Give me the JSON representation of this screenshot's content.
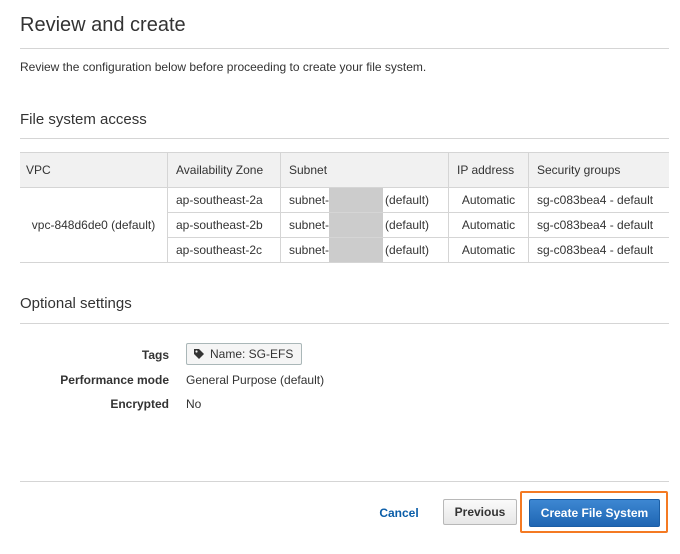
{
  "page": {
    "title": "Review and create",
    "intro": "Review the configuration below before proceeding to create your file system."
  },
  "access": {
    "section_title": "File system access",
    "headers": [
      "VPC",
      "Availability Zone",
      "Subnet",
      "IP address",
      "Security groups"
    ],
    "vpc": "vpc-848d6de0 (default)",
    "rows": [
      {
        "az": "ap-southeast-2a",
        "subnet_prefix": "subnet-",
        "subnet_suffix": "(default)",
        "ip": "Automatic",
        "sg": "sg-c083bea4 - default"
      },
      {
        "az": "ap-southeast-2b",
        "subnet_prefix": "subnet-",
        "subnet_suffix": "(default)",
        "ip": "Automatic",
        "sg": "sg-c083bea4 - default"
      },
      {
        "az": "ap-southeast-2c",
        "subnet_prefix": "subnet-",
        "subnet_suffix": "(default)",
        "ip": "Automatic",
        "sg": "sg-c083bea4 - default"
      }
    ]
  },
  "optional": {
    "section_title": "Optional settings",
    "tags_label": "Tags",
    "tag_value": "Name: SG-EFS",
    "tag_icon": "tag-icon",
    "performance_label": "Performance mode",
    "performance_value": "General Purpose (default)",
    "encrypted_label": "Encrypted",
    "encrypted_value": "No"
  },
  "actions": {
    "cancel": "Cancel",
    "previous": "Previous",
    "create": "Create File System"
  },
  "colors": {
    "primary": "#1f66b3",
    "highlight": "#f47a23",
    "link": "#0a5da8",
    "redaction": "#cccccc"
  }
}
